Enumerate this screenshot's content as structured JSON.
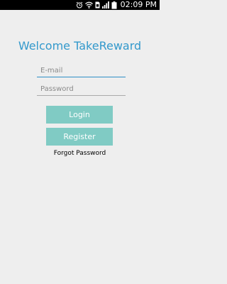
{
  "status_bar": {
    "time": "02:09 PM",
    "icons": [
      "alarm-icon",
      "wifi-icon",
      "sim-icon",
      "signal-icon",
      "battery-icon"
    ]
  },
  "login": {
    "title": "Welcome TakeReward",
    "email_placeholder": "E-mail",
    "email_value": "",
    "password_placeholder": "Password",
    "password_value": "",
    "login_label": "Login",
    "register_label": "Register",
    "forgot_label": "Forgot Password"
  },
  "colors": {
    "accent": "#3399cc",
    "button": "#80cbc4",
    "background": "#eeeeee",
    "status_bar": "#000000"
  }
}
